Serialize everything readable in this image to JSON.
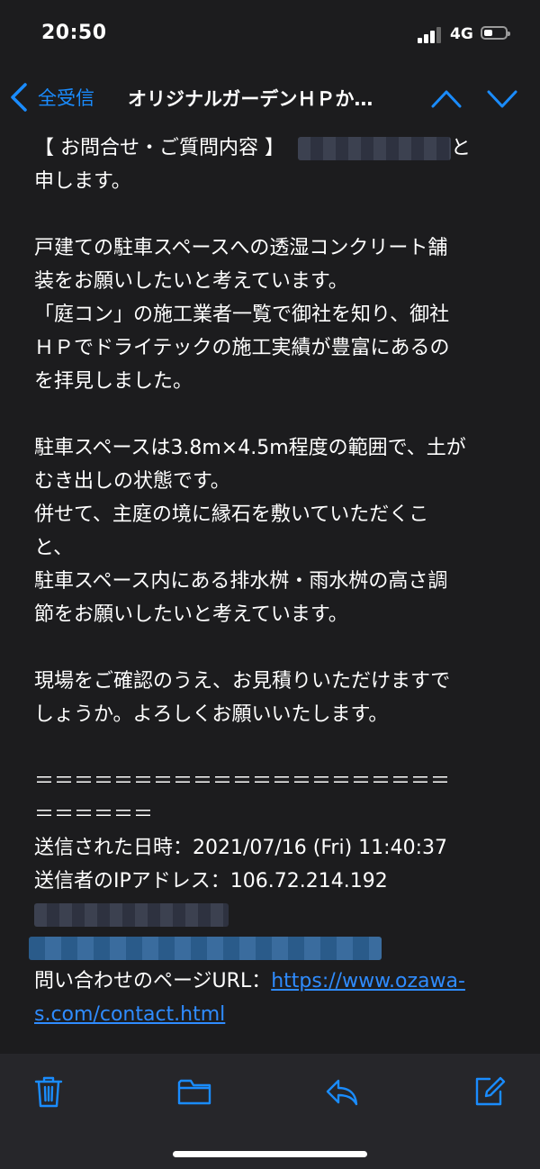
{
  "status_bar": {
    "time": "20:50",
    "network": "4G"
  },
  "nav": {
    "back_label": "全受信",
    "title": "オリジナルガーデンＨＰか…"
  },
  "email": {
    "lines": [
      "【 お問合せ・ご質問内容 】",
      "と",
      "申します。",
      "戸建ての駐車スペースへの透湿コンクリート舗",
      "装をお願いしたいと考えています。",
      "「庭コン」の施工業者一覧で御社を知り、御社",
      "ＨＰでドライテックの施工実績が豊富にあるの",
      "を拝見しました。",
      "駐車スペースは3.8m×4.5m程度の範囲で、土が",
      "むき出しの状態です。",
      "併せて、主庭の境に縁石を敷いていただくこ",
      "と、",
      "駐車スペース内にある排水桝・雨水桝の高さ調",
      "節をお願いしたいと考えています。",
      "現場をご確認のうえ、お見積りいただけますで",
      "しょうか。よろしくお願いいたします。",
      "＝＝＝＝＝＝＝＝＝＝＝＝＝＝＝＝＝＝＝＝＝",
      "＝＝＝＝＝＝",
      "送信された日時：2021/07/16 (Fri) 11:40:37",
      "送信者のIPアドレス：106.72.214.192",
      "問い合わせのページURL："
    ],
    "url_part1": "https://www.ozawa-",
    "url_part2": "s.com/contact.html"
  },
  "toolbar": {
    "icons": [
      "trash-icon",
      "folder-icon",
      "reply-icon",
      "compose-icon"
    ]
  },
  "colors": {
    "accent": "#1a8cff",
    "background": "#1c1c1e",
    "toolbar": "#26262a"
  }
}
